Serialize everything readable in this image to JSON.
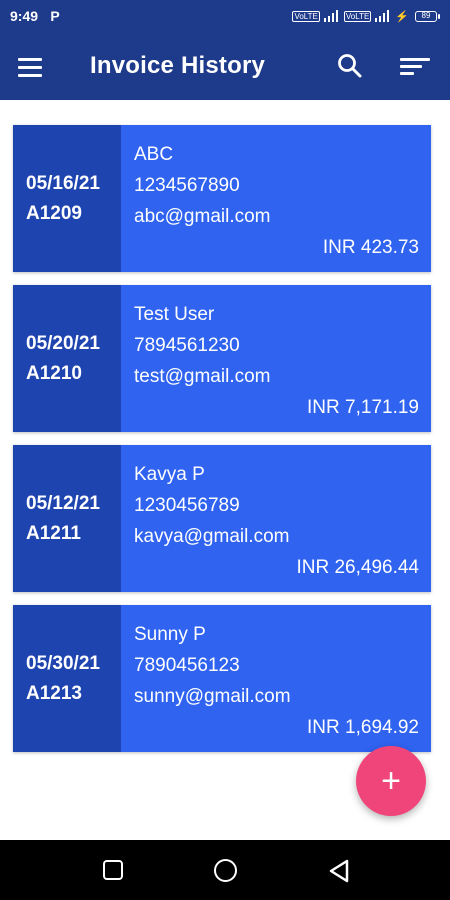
{
  "status_bar": {
    "time": "9:49",
    "notification": "P",
    "sim1_label": "VoLTE",
    "sim2_label": "VoLTE",
    "battery": "89"
  },
  "app_bar": {
    "title": "Invoice History",
    "icons": [
      "menu-icon",
      "search-icon",
      "sort-icon"
    ]
  },
  "invoices": [
    {
      "date": "05/16/21",
      "code": "A1209",
      "name": "ABC",
      "phone": "1234567890",
      "email": "abc@gmail.com",
      "amount": "INR 423.73"
    },
    {
      "date": "05/20/21",
      "code": "A1210",
      "name": "Test User",
      "phone": "7894561230",
      "email": "test@gmail.com",
      "amount": "INR 7,171.19"
    },
    {
      "date": "05/12/21",
      "code": "A1211",
      "name": "Kavya P",
      "phone": "1230456789",
      "email": "kavya@gmail.com",
      "amount": "INR 26,496.44"
    },
    {
      "date": "05/30/21",
      "code": "A1213",
      "name": "Sunny P",
      "phone": "7890456123",
      "email": "sunny@gmail.com",
      "amount": "INR 1,694.92"
    }
  ],
  "fab": {
    "label": "+",
    "icon": "add-icon"
  },
  "colors": {
    "app_bar": "#1e3a8a",
    "card": "#2f63f0",
    "card_left": "#1e44b0",
    "fab": "#f0457a"
  }
}
